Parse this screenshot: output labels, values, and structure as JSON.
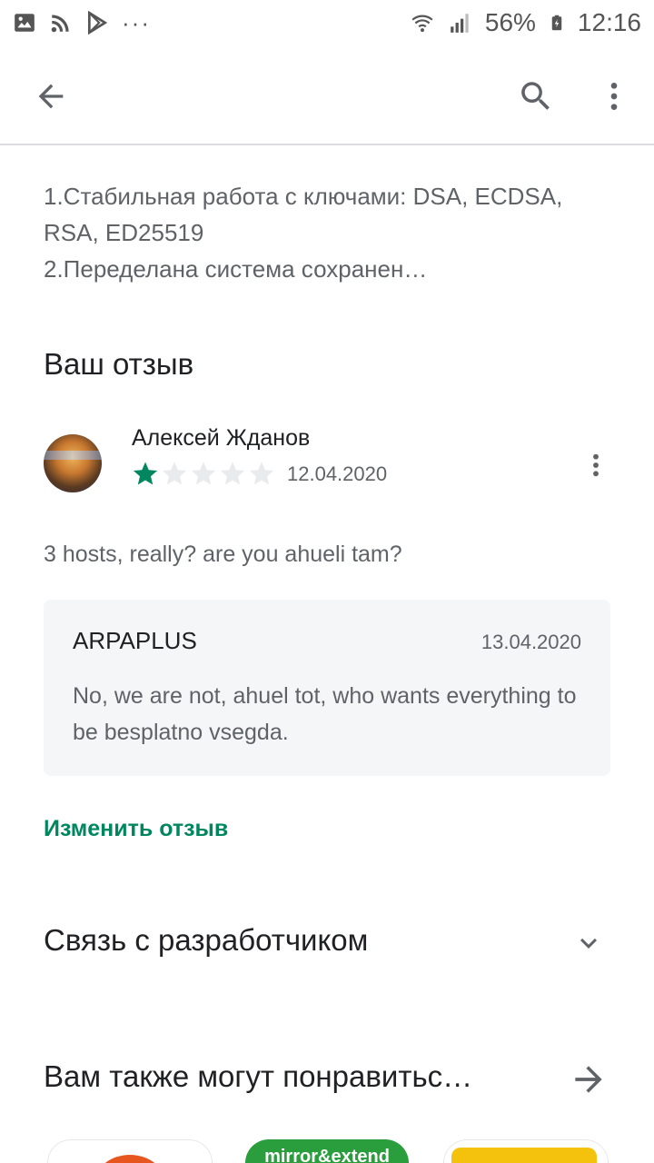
{
  "status_bar": {
    "battery": "56%",
    "time": "12:16"
  },
  "app_bar": {
    "back_icon": "arrow-back-icon",
    "search_icon": "search-icon",
    "menu_icon": "more-vert-icon"
  },
  "whats_new": {
    "lines": [
      "1.Стабильная работа с ключами: DSA, ECDSA,",
      "RSA, ED25519",
      "2.Переделана система сохранен…"
    ]
  },
  "your_review": {
    "title": "Ваш отзыв",
    "reviewer_name": "Алексей Жданов",
    "rating": 1,
    "rating_max": 5,
    "date": "12.04.2020",
    "text": "3 hosts, really? are you ahueli tam?",
    "developer_reply": {
      "name": "ARPAPLUS",
      "date": "13.04.2020",
      "text": "No, we are not, ahuel tot, who wants everything to be besplatno vsegda."
    },
    "edit_label": "Изменить отзыв"
  },
  "developer_contact": {
    "title": "Связь с разработчиком"
  },
  "similar_apps": {
    "title": "Вам также могут понравитьс…",
    "items": [
      {
        "label": ""
      },
      {
        "label": "mirror&extend"
      },
      {
        "label": ""
      }
    ]
  },
  "colors": {
    "accent": "#01875f",
    "star_filled": "#01875f",
    "star_empty": "#e8eaed"
  }
}
